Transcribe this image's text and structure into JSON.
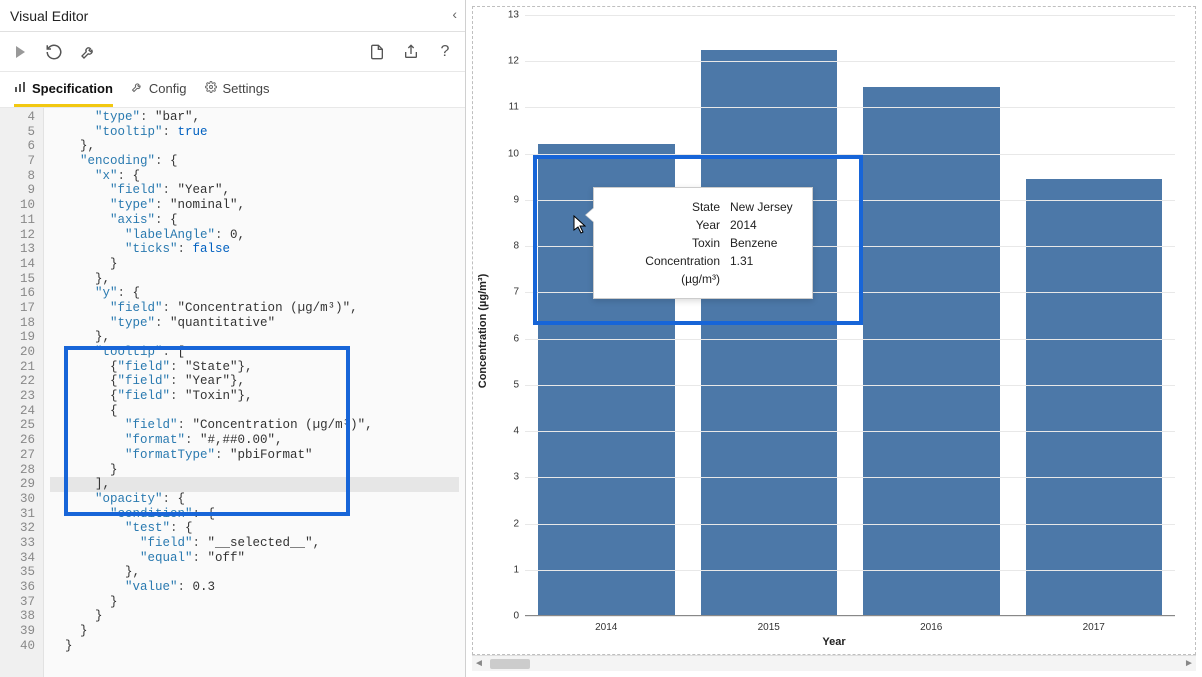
{
  "editor": {
    "title": "Visual Editor",
    "toolbar": {
      "run": "Run",
      "reset": "Reset",
      "settings": "Settings",
      "new": "New",
      "share": "Share",
      "help": "Help"
    },
    "tabs": {
      "specification": "Specification",
      "config": "Config",
      "settings": "Settings"
    }
  },
  "code_lines": [
    {
      "n": 4,
      "indent": 3,
      "raw": "\"type\": \"bar\","
    },
    {
      "n": 5,
      "indent": 3,
      "raw": "\"tooltip\": true"
    },
    {
      "n": 6,
      "indent": 2,
      "raw": "},"
    },
    {
      "n": 7,
      "indent": 2,
      "raw": "\"encoding\": {",
      "fold": true
    },
    {
      "n": 8,
      "indent": 3,
      "raw": "\"x\": {",
      "fold": true
    },
    {
      "n": 9,
      "indent": 4,
      "raw": "\"field\": \"Year\","
    },
    {
      "n": 10,
      "indent": 4,
      "raw": "\"type\": \"nominal\","
    },
    {
      "n": 11,
      "indent": 4,
      "raw": "\"axis\": {",
      "fold": true
    },
    {
      "n": 12,
      "indent": 5,
      "raw": "\"labelAngle\": 0,"
    },
    {
      "n": 13,
      "indent": 5,
      "raw": "\"ticks\": false"
    },
    {
      "n": 14,
      "indent": 4,
      "raw": "}"
    },
    {
      "n": 15,
      "indent": 3,
      "raw": "},"
    },
    {
      "n": 16,
      "indent": 3,
      "raw": "\"y\": {",
      "fold": true
    },
    {
      "n": 17,
      "indent": 4,
      "raw": "\"field\": \"Concentration (µg/m³)\","
    },
    {
      "n": 18,
      "indent": 4,
      "raw": "\"type\": \"quantitative\""
    },
    {
      "n": 19,
      "indent": 3,
      "raw": "},"
    },
    {
      "n": 20,
      "indent": 3,
      "raw": "\"tooltip\": [",
      "fold": true
    },
    {
      "n": 21,
      "indent": 4,
      "raw": "{\"field\": \"State\"},"
    },
    {
      "n": 22,
      "indent": 4,
      "raw": "{\"field\": \"Year\"},"
    },
    {
      "n": 23,
      "indent": 4,
      "raw": "{\"field\": \"Toxin\"},"
    },
    {
      "n": 24,
      "indent": 4,
      "raw": "{",
      "fold": true
    },
    {
      "n": 25,
      "indent": 5,
      "raw": "\"field\": \"Concentration (µg/m³)\","
    },
    {
      "n": 26,
      "indent": 5,
      "raw": "\"format\": \"#,##0.00\","
    },
    {
      "n": 27,
      "indent": 5,
      "raw": "\"formatType\": \"pbiFormat\""
    },
    {
      "n": 28,
      "indent": 4,
      "raw": "}"
    },
    {
      "n": 29,
      "indent": 3,
      "raw": "],",
      "current": true
    },
    {
      "n": 30,
      "indent": 3,
      "raw": "\"opacity\": {",
      "fold": true
    },
    {
      "n": 31,
      "indent": 4,
      "raw": "\"condition\": {",
      "fold": true
    },
    {
      "n": 32,
      "indent": 5,
      "raw": "\"test\": {",
      "fold": true
    },
    {
      "n": 33,
      "indent": 6,
      "raw": "\"field\": \"__selected__\","
    },
    {
      "n": 34,
      "indent": 6,
      "raw": "\"equal\": \"off\""
    },
    {
      "n": 35,
      "indent": 5,
      "raw": "},"
    },
    {
      "n": 36,
      "indent": 5,
      "raw": "\"value\": 0.3"
    },
    {
      "n": 37,
      "indent": 4,
      "raw": "}"
    },
    {
      "n": 38,
      "indent": 3,
      "raw": "}"
    },
    {
      "n": 39,
      "indent": 2,
      "raw": "}"
    },
    {
      "n": 40,
      "indent": 1,
      "raw": "}"
    }
  ],
  "chart_data": {
    "type": "bar",
    "categories": [
      "2014",
      "2015",
      "2016",
      "2017"
    ],
    "values": [
      10.2,
      12.25,
      11.45,
      9.45
    ],
    "xlabel": "Year",
    "ylabel": "Concentration (µg/m³)",
    "ylim": [
      0,
      13
    ],
    "yticks": [
      0,
      1,
      2,
      3,
      4,
      5,
      6,
      7,
      8,
      9,
      10,
      11,
      12,
      13
    ],
    "bar_color": "#4c78a8",
    "tooltip": {
      "rows": [
        {
          "key": "State",
          "val": "New Jersey"
        },
        {
          "key": "Year",
          "val": "2014"
        },
        {
          "key": "Toxin",
          "val": "Benzene"
        },
        {
          "key": "Concentration (µg/m³)",
          "val": "1.31"
        }
      ]
    }
  }
}
